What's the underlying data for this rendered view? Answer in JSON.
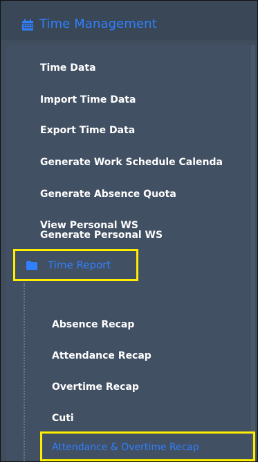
{
  "section": {
    "title": "Time Management",
    "icon": "calendar-icon",
    "color": "#2f80ff"
  },
  "menu": {
    "items": [
      {
        "label": "Time Data"
      },
      {
        "label": "Import Time Data"
      },
      {
        "label": "Export Time Data"
      },
      {
        "label": "Generate Work Schedule Calenda"
      },
      {
        "label": "Generate Absence Quota"
      },
      {
        "label": "View Personal WS"
      },
      {
        "label": "Generate Personal WS"
      }
    ]
  },
  "folder": {
    "label": "Time Report",
    "icon": "folder-icon",
    "highlight_color": "#ffee00",
    "items": [
      {
        "label": "Absence Recap"
      },
      {
        "label": "Attendance Recap"
      },
      {
        "label": "Overtime Recap"
      },
      {
        "label": "Cuti"
      },
      {
        "label": "Attendance & Overtime Recap",
        "active": true
      }
    ]
  }
}
